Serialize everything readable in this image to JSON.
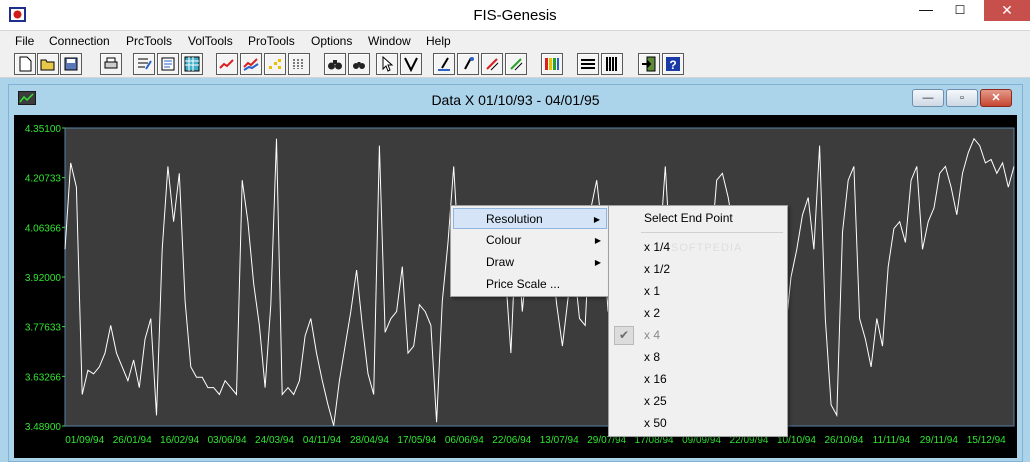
{
  "app": {
    "title": "FIS-Genesis",
    "close_glyph": "✕",
    "min_glyph": "—",
    "max_glyph": "☐"
  },
  "menubar": [
    "File",
    "Connection",
    "PrcTools",
    "VolTools",
    "ProTools",
    "Options",
    "Window",
    "Help"
  ],
  "toolbar": {
    "buttons": [
      "new-icon",
      "open-icon",
      "save-icon",
      "print-icon",
      "edit-icon",
      "note-icon",
      "grid-icon",
      "line-chart-icon",
      "multi-line-icon",
      "scatter-icon",
      "bars-icon",
      "binoculars-icon",
      "binoculars-small-icon",
      "pointer-icon",
      "vee-icon",
      "pen-blue-icon",
      "pen-dot-icon",
      "pen-red-icon",
      "pen-green-icon",
      "color-bars-icon",
      "lines-icon",
      "columns-icon",
      "exit-icon",
      "help-icon"
    ]
  },
  "child": {
    "title": "Data X 01/10/93 - 04/01/95",
    "min_glyph": "—",
    "max_glyph": "▫",
    "close_glyph": "✕"
  },
  "chart_data": {
    "type": "line",
    "y_ticks": [
      "4.35100",
      "4.20733",
      "4.06366",
      "3.92000",
      "3.77633",
      "3.63266",
      "3.48900"
    ],
    "ylim": [
      3.489,
      4.351
    ],
    "x_ticks": [
      "01/09/94",
      "26/01/94",
      "16/02/94",
      "03/06/94",
      "24/03/94",
      "04/11/94",
      "28/04/94",
      "17/05/94",
      "06/06/94",
      "22/06/94",
      "13/07/94",
      "29/07/94",
      "17/08/94",
      "09/09/94",
      "22/09/94",
      "10/10/94",
      "26/10/94",
      "11/11/94",
      "29/11/94",
      "15/12/94"
    ],
    "series": [
      {
        "values": [
          4.0,
          4.25,
          4.18,
          3.58,
          3.65,
          3.64,
          3.66,
          3.7,
          3.78,
          3.7,
          3.66,
          3.62,
          3.68,
          3.6,
          3.74,
          3.8,
          3.52,
          4.0,
          4.24,
          4.08,
          4.22,
          3.85,
          3.66,
          3.63,
          3.63,
          3.6,
          3.6,
          3.58,
          3.62,
          3.6,
          3.58,
          4.2,
          4.08,
          3.9,
          3.78,
          3.6,
          3.84,
          4.32,
          3.58,
          3.6,
          3.58,
          3.62,
          3.75,
          3.8,
          3.7,
          3.62,
          3.55,
          3.49,
          3.62,
          3.72,
          3.82,
          3.94,
          3.78,
          3.64,
          3.58,
          4.3,
          3.76,
          3.8,
          3.82,
          3.95,
          3.7,
          3.72,
          3.84,
          3.82,
          3.78,
          3.5,
          3.85,
          4.02,
          4.24,
          3.95,
          4.05,
          4.0,
          3.94,
          3.92,
          3.95,
          3.99,
          3.9,
          3.94,
          3.7,
          4.08,
          3.82,
          4.0,
          4.05,
          3.88,
          4.1,
          4.0,
          3.84,
          3.72,
          3.86,
          3.96,
          3.8,
          3.78,
          4.12,
          4.2,
          4.05,
          3.82,
          3.9,
          3.84,
          4.02,
          3.76,
          3.62,
          3.6,
          3.7,
          4.1,
          4.0,
          4.24,
          3.95,
          4.06,
          4.02,
          3.78,
          3.84,
          3.9,
          3.96,
          4.0,
          4.2,
          4.22,
          4.15,
          4.05,
          3.98,
          3.86,
          3.74,
          3.96,
          3.9,
          3.8,
          3.72,
          3.6,
          3.76,
          3.92,
          4.0,
          4.1,
          4.15,
          4.0,
          4.3,
          3.8,
          3.55,
          3.52,
          4.05,
          4.2,
          4.24,
          3.8,
          3.74,
          3.66,
          3.8,
          3.72,
          3.95,
          4.06,
          4.08,
          4.02,
          4.2,
          4.24,
          4.0,
          4.08,
          4.12,
          4.22,
          4.24,
          4.18,
          4.1,
          4.22,
          4.28,
          4.32,
          4.3,
          4.25,
          4.26,
          4.22,
          4.25,
          4.18,
          4.24
        ]
      }
    ]
  },
  "context_menu": {
    "items": [
      {
        "label": "Resolution",
        "has_submenu": true,
        "highlighted": true
      },
      {
        "label": "Colour",
        "has_submenu": true,
        "highlighted": false
      },
      {
        "label": "Draw",
        "has_submenu": true,
        "highlighted": false
      },
      {
        "label": "Price Scale ...",
        "has_submenu": false,
        "highlighted": false
      }
    ],
    "arrow_glyph": "▶"
  },
  "submenu": {
    "header": "Select End Point",
    "items": [
      {
        "label": "x 1/4",
        "checked": false,
        "disabled": false
      },
      {
        "label": "x 1/2",
        "checked": false,
        "disabled": false
      },
      {
        "label": "x 1",
        "checked": false,
        "disabled": false
      },
      {
        "label": "x 2",
        "checked": false,
        "disabled": false
      },
      {
        "label": "x 4",
        "checked": true,
        "disabled": true
      },
      {
        "label": "x 8",
        "checked": false,
        "disabled": false
      },
      {
        "label": "x 16",
        "checked": false,
        "disabled": false
      },
      {
        "label": "x 25",
        "checked": false,
        "disabled": false
      },
      {
        "label": "x 50",
        "checked": false,
        "disabled": false
      }
    ],
    "check_glyph": "✔"
  },
  "watermark": "SOFTPEDIA",
  "colors": {
    "plot_bg": "#3c3c3c",
    "line": "#ffffff",
    "axis_text": "#32e632",
    "accent": "#abd3ea"
  }
}
